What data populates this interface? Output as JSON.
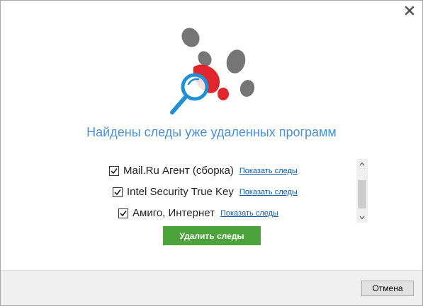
{
  "dialog": {
    "title": "Найдены следы уже удаленных программ",
    "items": [
      {
        "checked": true,
        "name": "Mail.Ru Агент (сборка)",
        "link": "Показать следы"
      },
      {
        "checked": true,
        "name": "Intel Security True Key",
        "link": "Показать следы"
      },
      {
        "checked": true,
        "name": "Амиго, Интернет",
        "link": "Показать следы"
      }
    ],
    "primary_button": "Удалить следы",
    "cancel_button": "Отмена"
  },
  "icons": {
    "close": "close-icon",
    "hero": "footprints-magnifier-icon",
    "checkbox": "checkmark-icon",
    "scroll_up": "chevron-up-icon",
    "scroll_down": "chevron-down-icon"
  },
  "colors": {
    "title": "#4a90d9",
    "primary_button": "#4ca33a",
    "link": "#0b5cad",
    "footprint_gray": "#757575",
    "footprint_red": "#e0262c",
    "magnifier_blue": "#1f8fd6"
  }
}
